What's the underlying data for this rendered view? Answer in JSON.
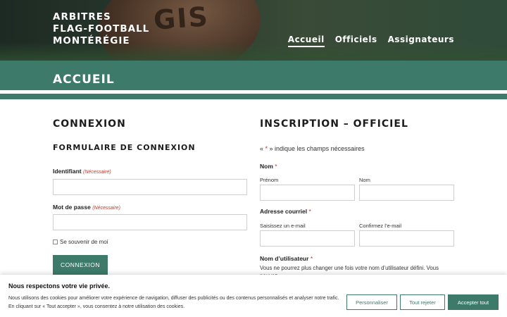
{
  "brand": {
    "line1": "ARBITRES",
    "line2": "FLAG-FOOTBALL",
    "line3": "MONTÉRÉGIE"
  },
  "hero": {
    "ball_text": "GIS"
  },
  "nav": {
    "items": [
      {
        "label": "Accueil"
      },
      {
        "label": "Officiels"
      },
      {
        "label": "Assignateurs"
      }
    ]
  },
  "page": {
    "title": "ACCUEIL"
  },
  "login": {
    "title": "CONNEXION",
    "subtitle": "FORMULAIRE DE CONNEXION",
    "username_label": "Identifiant",
    "password_label": "Mot de passe",
    "required_tag": "(Nécessaire)",
    "remember_label": "Se souvenir de moi",
    "button_label": "CONNEXION"
  },
  "register": {
    "title": "INSCRIPTION – OFFICIEL",
    "required_note_prefix": "« ",
    "required_note_star": "*",
    "required_note_suffix": " » indique les champs nécessaires",
    "name_label": "Nom",
    "first_name_label": "Prénom",
    "last_name_label": "Nom",
    "email_label": "Adresse courriel",
    "email_enter_label": "Saisissez un e-mail",
    "email_confirm_label": "Confirmez l’e-mail",
    "username_label": "Nom d’utilisateur",
    "username_note": "Vous ne pourrez plus changer une fois votre nom d’utilisateur défini. Vous pouvez",
    "asterisk": "*"
  },
  "cookie": {
    "title": "Nous respectons votre vie privée.",
    "text_line1": "Nous utilisons des cookies pour améliorer votre expérience de navigation, diffuser des publicités ou des contenus personnalisés et analyser notre trafic.",
    "text_line2": "En cliquant sur « Tout accepter », vous consentez à notre utilisation des cookies.",
    "customize_label": "Personnaliser",
    "reject_label": "Tout rejeter",
    "accept_label": "Accepter tout"
  },
  "colors": {
    "accent": "#3d7a69",
    "required": "#c0392b"
  }
}
